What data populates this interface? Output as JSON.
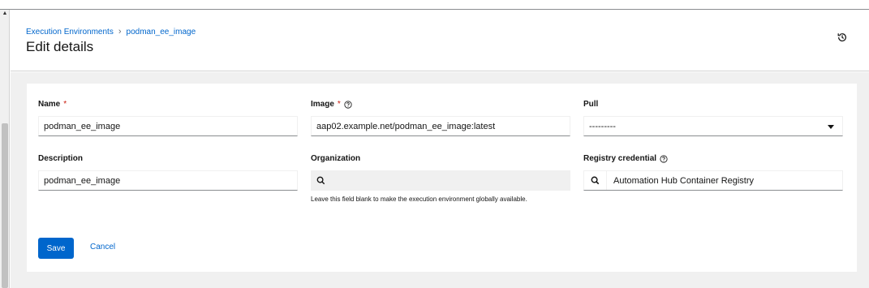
{
  "breadcrumb": {
    "parent": "Execution Environments",
    "current": "podman_ee_image"
  },
  "header": {
    "title": "Edit details"
  },
  "form": {
    "name": {
      "label": "Name",
      "required_mark": "*",
      "value": "podman_ee_image"
    },
    "image": {
      "label": "Image",
      "required_mark": "*",
      "value": "aap02.example.net/podman_ee_image:latest"
    },
    "pull": {
      "label": "Pull",
      "value": "---------"
    },
    "description": {
      "label": "Description",
      "value": "podman_ee_image"
    },
    "organization": {
      "label": "Organization",
      "value": "",
      "helper": "Leave this field blank to make the execution environment globally available."
    },
    "registry_credential": {
      "label": "Registry credential",
      "value": "Automation Hub Container Registry"
    }
  },
  "actions": {
    "save_label": "Save",
    "cancel_label": "Cancel"
  },
  "icons": {
    "history": "history-icon",
    "help": "question-circle-icon",
    "search": "search-icon",
    "dropdown": "caret-down-icon"
  },
  "colors": {
    "link": "#0066cc",
    "primary_button": "#0066cc",
    "required": "#c9190b",
    "page_background": "#f0f0f0"
  }
}
